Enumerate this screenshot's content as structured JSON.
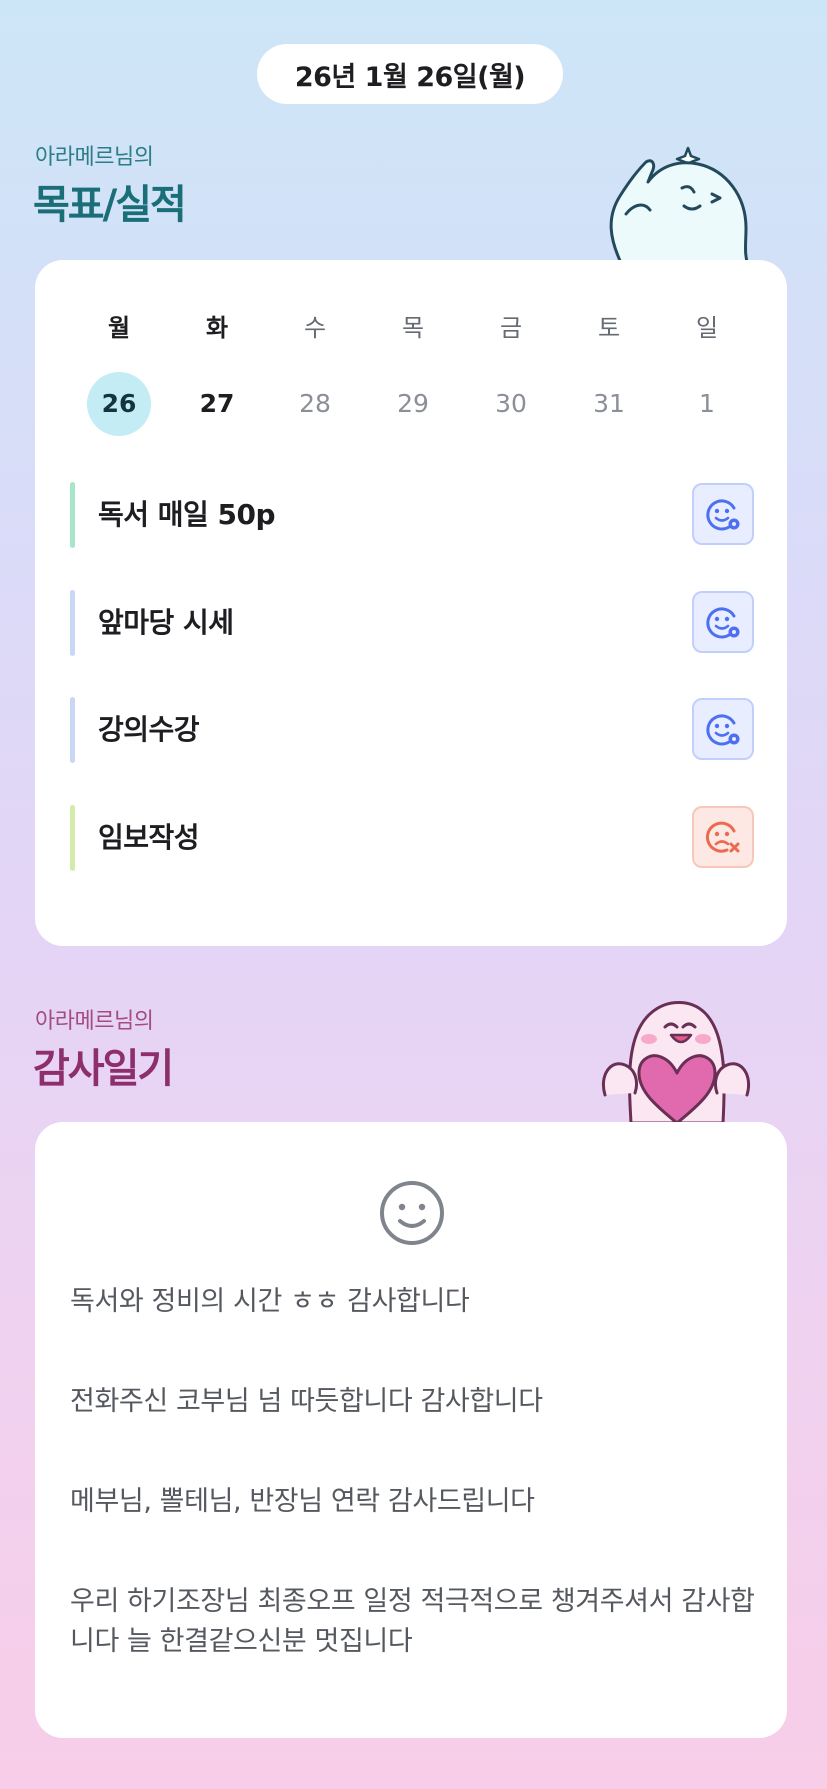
{
  "header": {
    "date": "26년 1월 26일(월)"
  },
  "goals_section": {
    "owner_label": "아라메르님의",
    "title": "목표/실적",
    "weekdays": [
      "월",
      "화",
      "수",
      "목",
      "금",
      "토",
      "일"
    ],
    "dates": [
      "26",
      "27",
      "28",
      "29",
      "30",
      "31",
      "1"
    ],
    "today_index": 0,
    "goals": [
      {
        "name": "독서 매일 50p",
        "bar_color": "#a7e6c8",
        "status": "smile-icon"
      },
      {
        "name": "앞마당 시세",
        "bar_color": "#c9d6f6",
        "status": "smile-icon"
      },
      {
        "name": "강의수강",
        "bar_color": "#c9d6f6",
        "status": "smile-icon"
      },
      {
        "name": "임보작성",
        "bar_color": "#d3ecaa",
        "status": "sad-icon"
      }
    ]
  },
  "gratitude_section": {
    "owner_label": "아라메르님의",
    "title": "감사일기",
    "mood_icon": "smile-outline-icon",
    "entries": [
      "독서와 정비의 시간 ㅎㅎ 감사합니다",
      "전화주신 코부님 넘 따듯합니다 감사합니다",
      "메부님, 뽈테님, 반장님 연락 감사드립니다",
      "우리 하기조장님 최종오프 일정 적극적으로 챙겨주셔서 감사합니다 늘 한결같으신분 멋집니다"
    ]
  },
  "colors": {
    "today_circle": "#c3ecf5",
    "ok_icon": "#4d6ff2",
    "ng_icon": "#ec6a4f",
    "goal_title": "#1a6e78",
    "gratitude_title": "#8c2f6c"
  }
}
